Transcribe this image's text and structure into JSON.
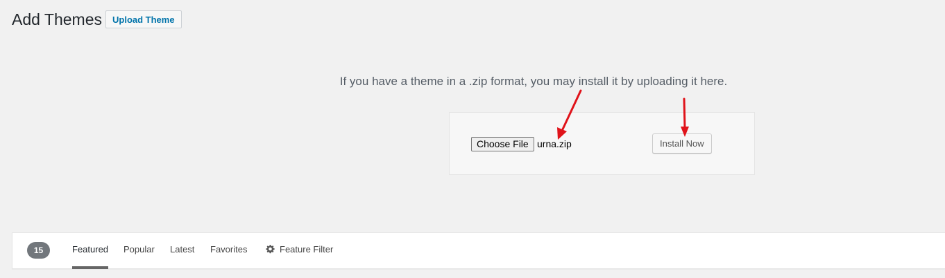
{
  "header": {
    "title": "Add Themes",
    "upload_label": "Upload Theme"
  },
  "upload": {
    "description": "If you have a theme in a .zip format, you may install it by uploading it here.",
    "choose_file_label": "Choose File",
    "file_name": "urna.zip",
    "install_label": "Install Now"
  },
  "filter_bar": {
    "count": "15",
    "tabs": [
      {
        "label": "Featured",
        "current": true
      },
      {
        "label": "Popular",
        "current": false
      },
      {
        "label": "Latest",
        "current": false
      },
      {
        "label": "Favorites",
        "current": false
      }
    ],
    "feature_filter_label": "Feature Filter",
    "feature_filter_icon": "gear-icon"
  },
  "colors": {
    "background": "#f1f1f1",
    "link": "#0073aa",
    "annotation_arrow": "#e0131a"
  }
}
